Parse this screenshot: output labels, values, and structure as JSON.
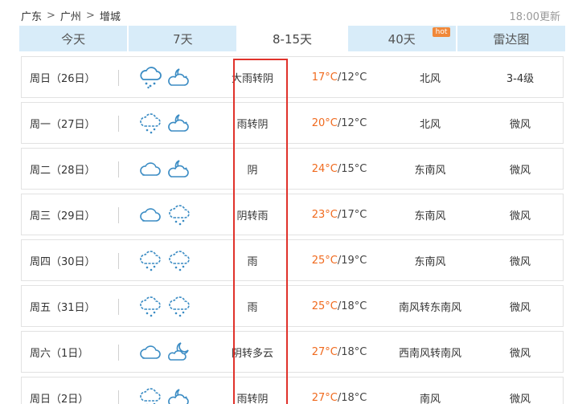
{
  "breadcrumb": {
    "items": [
      "广东",
      "广州",
      "增城"
    ],
    "separator": ">"
  },
  "update_time": "18:00更新",
  "tabs": [
    {
      "label": "今天",
      "active": false,
      "badge": ""
    },
    {
      "label": "7天",
      "active": false,
      "badge": ""
    },
    {
      "label": "8-15天",
      "active": true,
      "badge": ""
    },
    {
      "label": "40天",
      "active": false,
      "badge": "hot"
    },
    {
      "label": "雷达图",
      "active": false,
      "badge": ""
    }
  ],
  "colors": {
    "high_temp": "#f06a1e",
    "tab_bg": "#d8ecf9",
    "highlight_box": "#e0322b",
    "icon_stroke": "#3b8cc4"
  },
  "forecast": [
    {
      "date": "周日（26日）",
      "icon_day": "heavy-rain-icon",
      "icon_night": "cloudy-night-icon",
      "desc": "大雨转阴",
      "high": "17°C",
      "low": "/12°C",
      "wind": "北风",
      "level": "3-4级"
    },
    {
      "date": "周一（27日）",
      "icon_day": "rain-icon",
      "icon_night": "cloudy-night-icon",
      "desc": "雨转阴",
      "high": "20°C",
      "low": "/12°C",
      "wind": "北风",
      "level": "微风"
    },
    {
      "date": "周二（28日）",
      "icon_day": "cloud-icon",
      "icon_night": "cloudy-night-icon",
      "desc": "阴",
      "high": "24°C",
      "low": "/15°C",
      "wind": "东南风",
      "level": "微风"
    },
    {
      "date": "周三（29日）",
      "icon_day": "cloud-icon",
      "icon_night": "rain-icon",
      "desc": "阴转雨",
      "high": "23°C",
      "low": "/17°C",
      "wind": "东南风",
      "level": "微风"
    },
    {
      "date": "周四（30日）",
      "icon_day": "rain-icon",
      "icon_night": "rain-icon",
      "desc": "雨",
      "high": "25°C",
      "low": "/19°C",
      "wind": "东南风",
      "level": "微风"
    },
    {
      "date": "周五（31日）",
      "icon_day": "rain-icon",
      "icon_night": "rain-icon",
      "desc": "雨",
      "high": "25°C",
      "low": "/18°C",
      "wind": "南风转东南风",
      "level": "微风"
    },
    {
      "date": "周六（1日）",
      "icon_day": "cloud-icon",
      "icon_night": "partly-cloudy-night-icon",
      "desc": "阴转多云",
      "high": "27°C",
      "low": "/18°C",
      "wind": "西南风转南风",
      "level": "微风"
    },
    {
      "date": "周日（2日）",
      "icon_day": "rain-icon",
      "icon_night": "cloudy-night-icon",
      "desc": "雨转阴",
      "high": "27°C",
      "low": "/18°C",
      "wind": "南风",
      "level": "微风"
    }
  ]
}
